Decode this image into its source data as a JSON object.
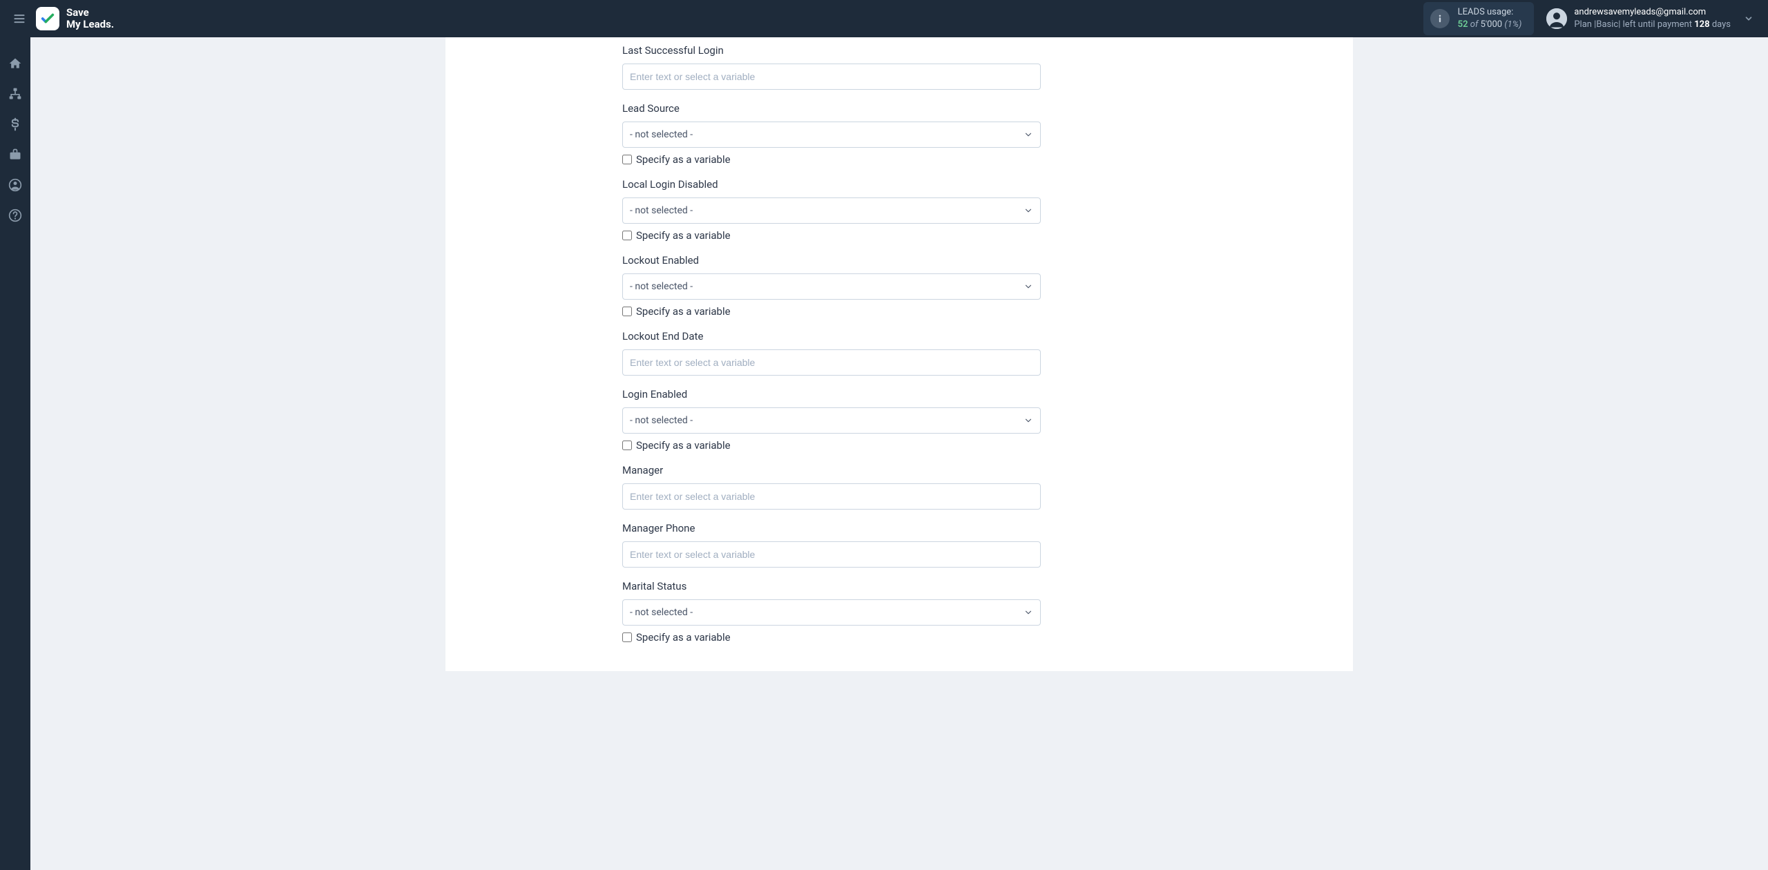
{
  "header": {
    "logo_line1": "Save",
    "logo_line2": "My Leads.",
    "usage": {
      "label": "LEADS usage:",
      "current": "52",
      "of_word": "of",
      "total": "5'000",
      "percent": "(1%)"
    },
    "account": {
      "email": "andrewsavemyleads@gmail.com",
      "plan_prefix": "Plan |",
      "plan_name": "Basic",
      "plan_sep": "| left until payment ",
      "days_number": "128",
      "days_word": " days"
    }
  },
  "form": {
    "text_placeholder": "Enter text or select a variable",
    "select_placeholder": "- not selected -",
    "variable_checkbox_label": "Specify as a variable",
    "fields": [
      {
        "label": "Last Successful Login",
        "type": "text"
      },
      {
        "label": "Lead Source",
        "type": "select",
        "has_variable_checkbox": true
      },
      {
        "label": "Local Login Disabled",
        "type": "select",
        "has_variable_checkbox": true
      },
      {
        "label": "Lockout Enabled",
        "type": "select",
        "has_variable_checkbox": true
      },
      {
        "label": "Lockout End Date",
        "type": "text"
      },
      {
        "label": "Login Enabled",
        "type": "select",
        "has_variable_checkbox": true
      },
      {
        "label": "Manager",
        "type": "text"
      },
      {
        "label": "Manager Phone",
        "type": "text"
      },
      {
        "label": "Marital Status",
        "type": "select",
        "has_variable_checkbox": true
      }
    ]
  }
}
